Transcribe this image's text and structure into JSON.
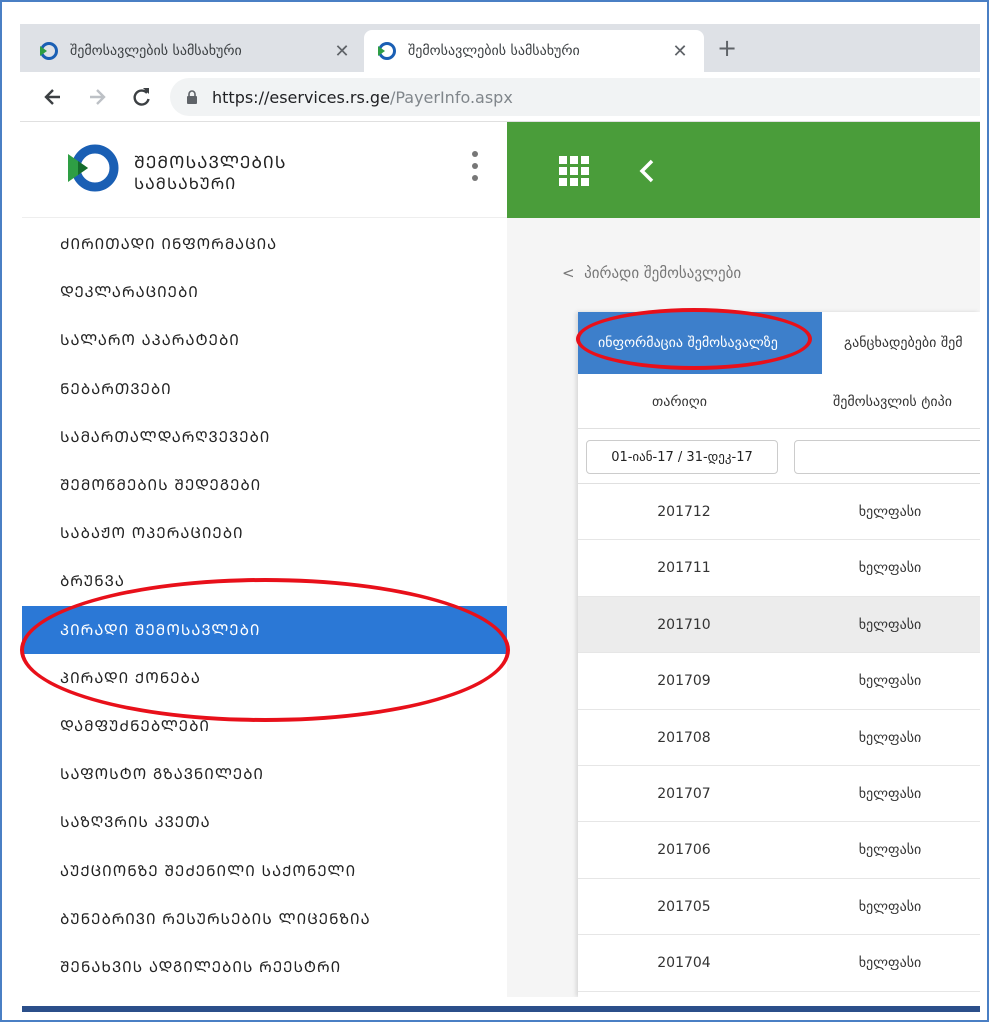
{
  "browser": {
    "tabs": [
      {
        "title": "შემოსავლების სამსახური",
        "close": "✕"
      },
      {
        "title": "შემოსავლების სამსახური",
        "close": "✕"
      }
    ],
    "new_tab": "+",
    "url_host": "https://eservices.rs.ge",
    "url_path": "/PayerInfo.aspx"
  },
  "brand": {
    "line1": "ᲨᲔᲛᲝᲡᲐᲕᲚᲔᲑᲘᲡ",
    "line2": "ᲡᲐᲛᲡᲐᲮᲣᲠᲘ"
  },
  "sidebar": {
    "items": [
      {
        "label": "ᲫᲘᲠᲘᲗᲐᲓᲘ ᲘᲜᲤᲝᲠᲛᲐᲪᲘᲐ"
      },
      {
        "label": "ᲓᲔᲙᲚᲐᲠᲐᲪᲘᲔᲑᲘ"
      },
      {
        "label": "ᲡᲐᲚᲐᲠᲝ ᲐᲞᲐᲠᲐᲢᲔᲑᲘ"
      },
      {
        "label": "ᲜᲔᲑᲐᲠᲗᲕᲔᲑᲘ"
      },
      {
        "label": "ᲡᲐᲛᲐᲠᲗᲐᲚᲓᲐᲠᲦᲕᲔᲕᲔᲑᲘ"
      },
      {
        "label": "ᲨᲔᲛᲝᲬᲛᲔᲑᲘᲡ ᲨᲔᲓᲔᲒᲔᲑᲘ"
      },
      {
        "label": "ᲡᲐᲑᲐᲟᲝ ᲝᲞᲔᲠᲐᲪᲘᲔᲑᲘ"
      },
      {
        "label": "ᲑᲠᲣᲜᲕᲐ"
      },
      {
        "label": "ᲞᲘᲠᲐᲓᲘ ᲨᲔᲛᲝᲡᲐᲕᲚᲔᲑᲘ",
        "active": true
      },
      {
        "label": "ᲞᲘᲠᲐᲓᲘ ᲥᲝᲜᲔᲑᲐ"
      },
      {
        "label": "ᲓᲐᲛᲤᲣᲫᲜᲔᲑᲚᲔᲑᲘ"
      },
      {
        "label": "ᲡᲐᲤᲝᲡᲢᲝ ᲒᲖᲐᲕᲜᲘᲚᲔᲑᲘ"
      },
      {
        "label": "ᲡᲐᲖᲦᲕᲠᲘᲡ ᲙᲕᲔᲗᲐ"
      },
      {
        "label": "ᲐᲣᲥᲪᲘᲝᲜᲖᲔ ᲨᲔᲫᲔᲜᲘᲚᲘ ᲡᲐᲥᲝᲜᲔᲚᲘ"
      },
      {
        "label": "ᲑᲣᲜᲔᲑᲠᲘᲕᲘ ᲠᲔᲡᲣᲠᲡᲔᲑᲘᲡ ᲚᲘᲪᲔᲜᲖᲘᲐ"
      },
      {
        "label": "ᲨᲔᲜᲐᲮᲕᲘᲡ ᲐᲓᲒᲘᲚᲔᲑᲘᲡ ᲠᲔᲔᲡᲢᲠᲘ"
      }
    ]
  },
  "breadcrumb": {
    "chevron": "<",
    "label": "პირადი შემოსავლები"
  },
  "panel": {
    "tabs": [
      {
        "label": "ინფორმაცია შემოსავალზე"
      },
      {
        "label": "განცხადებები შემ"
      }
    ],
    "columns": [
      "თარიღი",
      "შემოსავლის ტიპი"
    ],
    "filter_date": "01-იან-17 / 31-დეკ-17",
    "filter_type_placeholder": "",
    "rows": [
      {
        "date": "201712",
        "type": "ხელფასი"
      },
      {
        "date": "201711",
        "type": "ხელფასი"
      },
      {
        "date": "201710",
        "type": "ხელფასი"
      },
      {
        "date": "201709",
        "type": "ხელფასი"
      },
      {
        "date": "201708",
        "type": "ხელფასი"
      },
      {
        "date": "201707",
        "type": "ხელფასი"
      },
      {
        "date": "201706",
        "type": "ხელფასი"
      },
      {
        "date": "201705",
        "type": "ხელფასი"
      },
      {
        "date": "201704",
        "type": "ხელფასი"
      }
    ]
  },
  "colors": {
    "topbar_green": "#4a9d3a",
    "active_blue": "#2b78d6",
    "tab_blue": "#3d7fcb",
    "annotation_red": "#e8101a"
  }
}
